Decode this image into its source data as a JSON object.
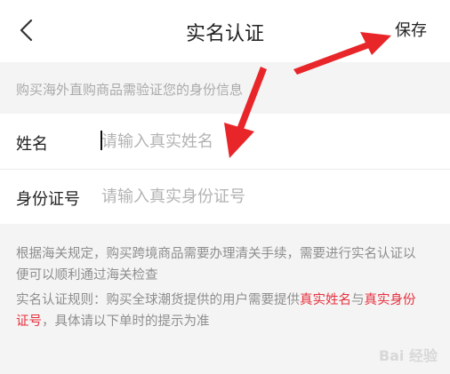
{
  "header": {
    "back_icon": "chevron-left-icon",
    "title": "实名认证",
    "save_label": "保存"
  },
  "notice": {
    "text": "购买海外直购商品需验证您的身份信息"
  },
  "form": {
    "name_label": "姓名",
    "name_placeholder": "请输入真实姓名",
    "id_label": "身份证号",
    "id_placeholder": "请输入真实身份证号"
  },
  "rules": {
    "paragraph1": "根据海关规定，购买跨境商品需要办理清关手续，需要进行实名认证以便可以顺利通过海关检查",
    "paragraph2_prefix": "实名认证规则：购买全球潮货提供的用户需要提供",
    "highlight_name": "真实姓名",
    "connector": "与",
    "highlight_id": "真实身份证号",
    "paragraph2_suffix": "，具体请以下单时的提示为准"
  },
  "colors": {
    "highlight": "#e7313e",
    "arrow": "#e8262a"
  },
  "watermark": "Bai 经验"
}
